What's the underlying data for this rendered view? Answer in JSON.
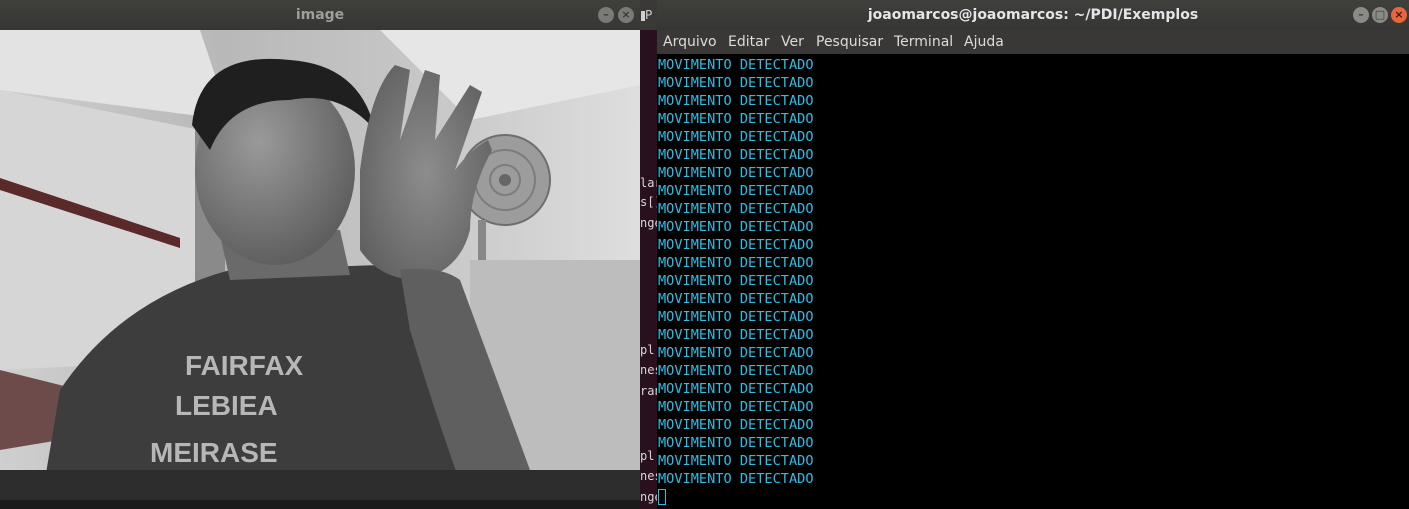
{
  "image_window": {
    "title": "image",
    "shirt_text": [
      "FAIRFAX",
      "LEBIEA",
      "MEIRASE"
    ]
  },
  "background_window": {
    "tab_label": "P",
    "fragments": [
      "lar",
      "s[]",
      "nge",
      "pl",
      "nes",
      "ran",
      "pl",
      "nes",
      "nge"
    ]
  },
  "terminal": {
    "title": "joaomarcos@joaomarcos: ~/PDI/Exemplos",
    "menu": [
      "Arquivo",
      "Editar",
      "Ver",
      "Pesquisar",
      "Terminal",
      "Ajuda"
    ],
    "lines": [
      "MOVIMENTO DETECTADO",
      "MOVIMENTO DETECTADO",
      "MOVIMENTO DETECTADO",
      "MOVIMENTO DETECTADO",
      "MOVIMENTO DETECTADO",
      "MOVIMENTO DETECTADO",
      "MOVIMENTO DETECTADO",
      "MOVIMENTO DETECTADO",
      "MOVIMENTO DETECTADO",
      "MOVIMENTO DETECTADO",
      "MOVIMENTO DETECTADO",
      "MOVIMENTO DETECTADO",
      "MOVIMENTO DETECTADO",
      "MOVIMENTO DETECTADO",
      "MOVIMENTO DETECTADO",
      "MOVIMENTO DETECTADO",
      "MOVIMENTO DETECTADO",
      "MOVIMENTO DETECTADO",
      "MOVIMENTO DETECTADO",
      "MOVIMENTO DETECTADO",
      "MOVIMENTO DETECTADO",
      "MOVIMENTO DETECTADO",
      "MOVIMENTO DETECTADO",
      "MOVIMENTO DETECTADO"
    ],
    "text_color": "#27c0e8"
  },
  "icons": {
    "image_minimize": "minimize-icon",
    "image_close": "close-icon",
    "terminal_minimize": "minimize-icon",
    "terminal_maximize": "maximize-icon",
    "terminal_close": "close-icon"
  }
}
